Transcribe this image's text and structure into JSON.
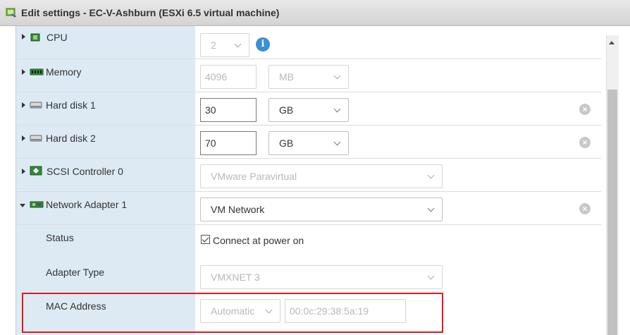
{
  "window": {
    "title": "Edit settings - EC-V-Ashburn (ESXi 6.5 virtual machine)"
  },
  "rows": {
    "cpu": {
      "label": "CPU",
      "value": "2"
    },
    "memory": {
      "label": "Memory",
      "value": "4096",
      "unit": "MB"
    },
    "hard_disk_1": {
      "label": "Hard disk 1",
      "value": "30",
      "unit": "GB"
    },
    "hard_disk_2": {
      "label": "Hard disk 2",
      "value": "70",
      "unit": "GB"
    },
    "scsi_controller": {
      "label": "SCSI Controller 0",
      "value": "VMware Paravirtual"
    },
    "network_adapter": {
      "label": "Network Adapter 1",
      "value": "VM Network"
    },
    "status": {
      "label": "Status",
      "checkbox_label": "Connect at power on",
      "checked": true
    },
    "adapter_type": {
      "label": "Adapter Type",
      "value": "VMXNET 3"
    },
    "mac_address": {
      "label": "MAC Address",
      "mode": "Automatic",
      "value": "00:0c:29:38:5a:19"
    }
  },
  "icons": {
    "title": "vm-settings-icon",
    "cpu": "cpu-chip-icon",
    "memory": "memory-icon",
    "hard_disk": "hard-disk-icon",
    "scsi": "scsi-controller-icon",
    "network": "network-adapter-icon",
    "info": "info-icon",
    "remove": "remove-icon"
  },
  "colors": {
    "label_column": "#ddeaf4",
    "info": "#3b8fd9",
    "highlight": "#e0191f"
  }
}
